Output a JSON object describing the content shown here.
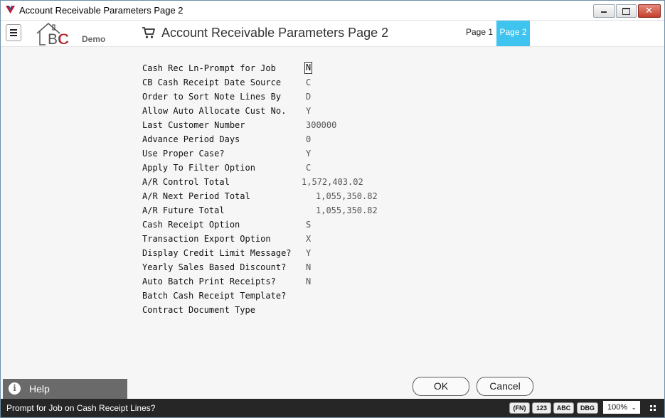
{
  "window": {
    "title": "Account Receivable Parameters Page 2"
  },
  "header": {
    "logo_text": "BC",
    "logo_demo": "Demo",
    "page_title": "Account Receivable Parameters Page 2",
    "tabs": [
      {
        "label": "Page 1",
        "active": false
      },
      {
        "label": "Page 2",
        "active": true
      }
    ],
    "active_tab_color": "#3fc3ef"
  },
  "fields": [
    {
      "label": "Cash Rec Ln-Prompt for Job",
      "value": "N"
    },
    {
      "label": "CB Cash Receipt Date Source",
      "value": "C"
    },
    {
      "label": "Order to Sort Note Lines By",
      "value": "D"
    },
    {
      "label": "Allow Auto Allocate Cust No.",
      "value": "Y"
    },
    {
      "label": "Last Customer Number",
      "value": "300000"
    },
    {
      "label": "Advance Period Days",
      "value": "0"
    },
    {
      "label": "Use Proper Case?",
      "value": "Y"
    },
    {
      "label": "Apply To Filter Option",
      "value": "C"
    },
    {
      "label": "A/R Control Total",
      "value": "1,572,403.02"
    },
    {
      "label": "A/R Next Period Total",
      "value": "1,055,350.82"
    },
    {
      "label": "A/R Future Total",
      "value": "1,055,350.82"
    },
    {
      "label": "Cash Receipt Option",
      "value": "S"
    },
    {
      "label": "Transaction Export Option",
      "value": "X"
    },
    {
      "label": "Display Credit Limit Message?",
      "value": "Y"
    },
    {
      "label": "Yearly Sales Based Discount?",
      "value": "N"
    },
    {
      "label": "Auto Batch Print Receipts?",
      "value": "N"
    },
    {
      "label": "Batch Cash Receipt Template?",
      "value": ""
    },
    {
      "label": "Contract Document Type",
      "value": ""
    }
  ],
  "buttons": {
    "ok": "OK",
    "cancel": "Cancel"
  },
  "help": {
    "label": "Help"
  },
  "status": {
    "message": "Prompt for Job on Cash Receipt Lines?",
    "badges": [
      "(FN)",
      "123",
      "ABC",
      "DBG"
    ],
    "zoom": "100%"
  }
}
